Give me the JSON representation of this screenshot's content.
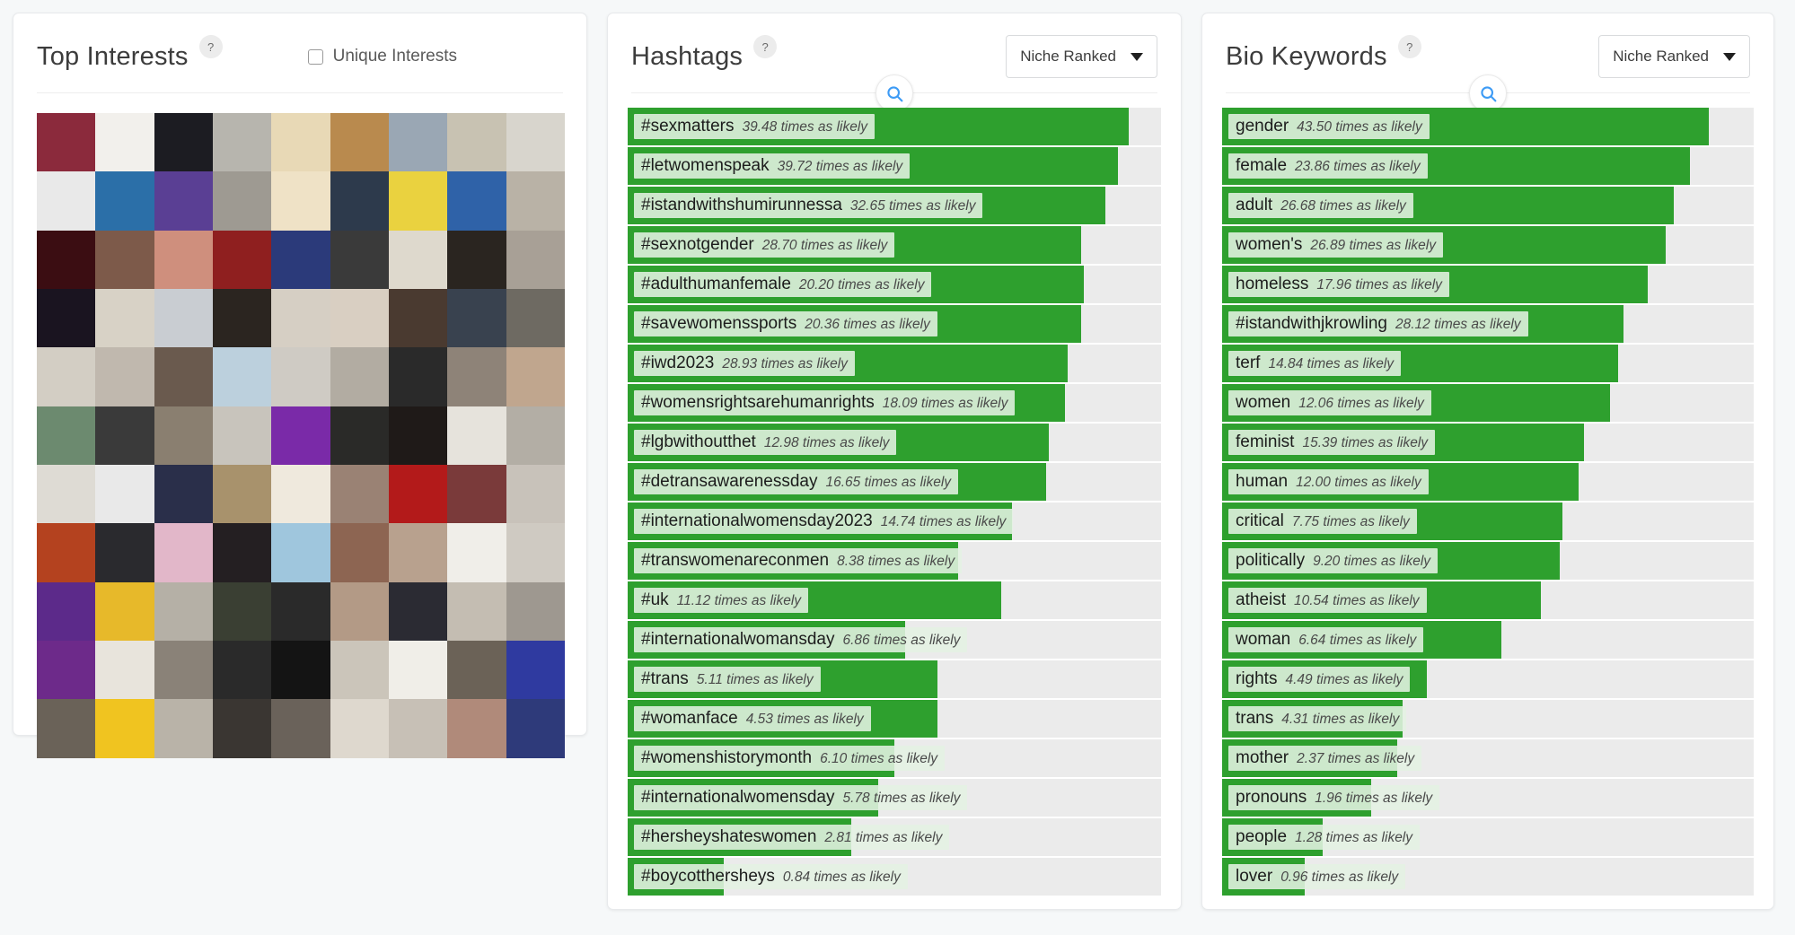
{
  "page": {
    "background": "#f6f8f9",
    "bar_color": "#2ea02e",
    "track_color": "#ebebeb",
    "label_chip_color": "#e4f1e2"
  },
  "panels": {
    "interests": {
      "title": "Top Interests",
      "help": "?",
      "checkbox_label": "Unique Interests",
      "checkbox_checked": false,
      "mosaic_columns": 9,
      "mosaic_rows": 11,
      "tiles": [
        "#8b2a3c",
        "#f2f0ec",
        "#1c1c22",
        "#b7b5ae",
        "#e8d9b6",
        "#b98a4e",
        "#9aa7b4",
        "#c8c2b2",
        "#d8d5cd",
        "#e9e9e9",
        "#2b6fa8",
        "#5a3f94",
        "#9e9a92",
        "#efe2c6",
        "#2d3a4c",
        "#ead23f",
        "#2f62a8",
        "#b9b2a6",
        "#3b0d12",
        "#7d5a4a",
        "#cf8f7d",
        "#8f1f1f",
        "#2b3a7a",
        "#3a3a3a",
        "#ded9cd",
        "#2a2520",
        "#a8a096",
        "#1a1420",
        "#d8d2c6",
        "#c9cdd2",
        "#2b2520",
        "#d6cfc4",
        "#d9cfc2",
        "#4a3a30",
        "#39424f",
        "#6e6a62",
        "#d3cec4",
        "#c0b8ae",
        "#6a5a4e",
        "#bcd0dd",
        "#cfcbc4",
        "#b2aca2",
        "#2a2a2a",
        "#8e8378",
        "#c0a68e",
        "#6c8a6f",
        "#3a3a3a",
        "#8a7f70",
        "#c8c4bc",
        "#7a2aa8",
        "#2a2a28",
        "#1f1a18",
        "#e6e3dc",
        "#b3aea5",
        "#dedbd4",
        "#e9e9e9",
        "#2a2f4a",
        "#a8926c",
        "#efe9dd",
        "#9a8274",
        "#b31a1a",
        "#7a3a3a",
        "#c8c2ba",
        "#b4421f",
        "#2a2a2e",
        "#e2b7c9",
        "#241f22",
        "#9fc6dd",
        "#8d6552",
        "#b8a18e",
        "#f0eee9",
        "#cfcac2",
        "#5c2a8a",
        "#e7b92a",
        "#b5b0a6",
        "#3a3f33",
        "#2a2a2a",
        "#b39a86",
        "#2b2b33",
        "#c4bdb2",
        "#9e9890",
        "#6d2a8a",
        "#e8e4dc",
        "#8a8278",
        "#2a2a2a",
        "#141414",
        "#cbc5ba",
        "#f0eee8",
        "#6b6257",
        "#2f3aa0",
        "#6a6258",
        "#f0c420",
        "#b9b3a8",
        "#3a3632",
        "#6a625a",
        "#ded8ce",
        "#c7c0b6",
        "#b08a7a",
        "#2e3a7a"
      ]
    },
    "hashtags": {
      "title": "Hashtags",
      "help": "?",
      "sort_label": "Niche Ranked",
      "search_icon": "search-icon",
      "unit": "times as likely"
    },
    "bio_keywords": {
      "title": "Bio Keywords",
      "help": "?",
      "sort_label": "Niche Ranked",
      "search_icon": "search-icon",
      "unit": "times as likely"
    }
  },
  "chart_data": [
    {
      "type": "bar",
      "title": "Hashtags",
      "orientation": "horizontal",
      "xlabel": "",
      "ylabel": "",
      "grid": false,
      "legend": null,
      "unit": "times as likely",
      "sort": "Niche Ranked",
      "categories": [
        "#sexmatters",
        "#letwomenspeak",
        "#istandwithshumirunnessa",
        "#sexnotgender",
        "#adulthumanfemale",
        "#savewomenssports",
        "#iwd2023",
        "#womensrightsarehumanrights",
        "#lgbwithoutthet",
        "#detransawarenessday",
        "#internationalwomensday2023",
        "#transwomenareconmen",
        "#uk",
        "#internationalwomansday",
        "#trans",
        "#womanface",
        "#womenshistorymonth",
        "#internationalwomensday",
        "#hersheyshateswomen",
        "#boycotthersheys"
      ],
      "values": [
        39.48,
        39.72,
        32.65,
        28.7,
        20.2,
        20.36,
        28.93,
        18.09,
        12.98,
        16.65,
        14.74,
        8.38,
        11.12,
        6.86,
        5.11,
        4.53,
        6.1,
        5.78,
        2.81,
        0.84
      ],
      "bar_pct": [
        94.0,
        92.0,
        89.5,
        85.0,
        85.5,
        85.0,
        82.5,
        82.0,
        79.0,
        78.5,
        72.0,
        62.0,
        70.0,
        52.0,
        58.0,
        58.0,
        50.0,
        47.0,
        42.0,
        18.0
      ]
    },
    {
      "type": "bar",
      "title": "Bio Keywords",
      "orientation": "horizontal",
      "xlabel": "",
      "ylabel": "",
      "grid": false,
      "legend": null,
      "unit": "times as likely",
      "sort": "Niche Ranked",
      "categories": [
        "gender",
        "female",
        "adult",
        "women's",
        "homeless",
        "#istandwithjkrowling",
        "terf",
        "women",
        "feminist",
        "human",
        "critical",
        "politically",
        "atheist",
        "woman",
        "rights",
        "trans",
        "mother",
        "pronouns",
        "people",
        "lover"
      ],
      "values": [
        43.5,
        23.86,
        26.68,
        26.89,
        17.96,
        28.12,
        14.84,
        12.06,
        15.39,
        12.0,
        7.75,
        9.2,
        10.54,
        6.64,
        4.49,
        4.31,
        2.37,
        1.96,
        1.28,
        0.96
      ],
      "bar_pct": [
        91.5,
        88.0,
        85.0,
        83.5,
        80.0,
        75.5,
        74.5,
        73.0,
        68.0,
        67.0,
        64.0,
        63.5,
        60.0,
        52.5,
        38.5,
        34.0,
        33.0,
        28.0,
        19.0,
        15.5
      ]
    }
  ]
}
